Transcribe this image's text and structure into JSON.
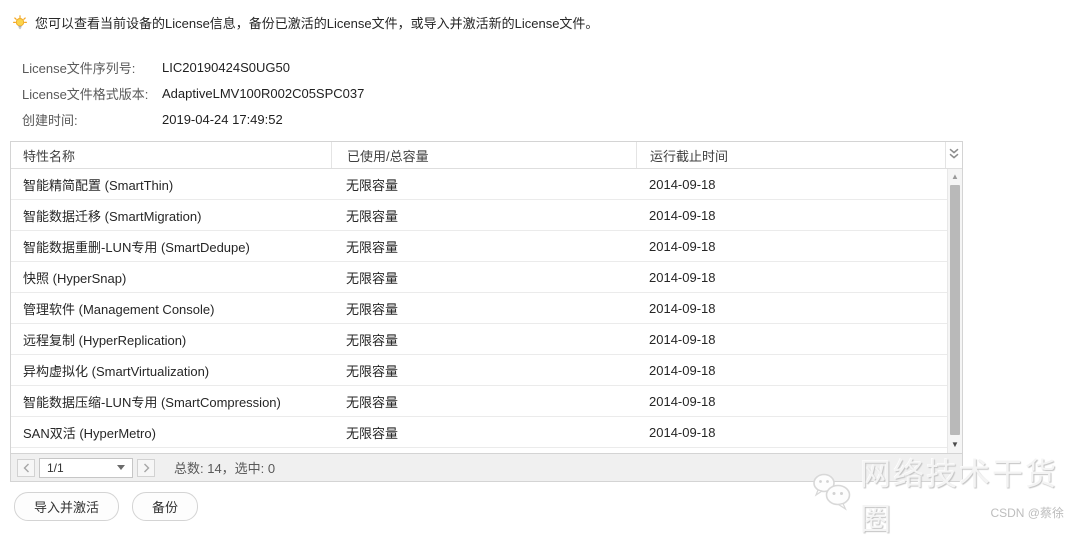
{
  "tip": {
    "text": "您可以查看当前设备的License信息，备份已激活的License文件，或导入并激活新的License文件。"
  },
  "info": {
    "serial_label": "License文件序列号:",
    "serial_value": "LIC20190424S0UG50",
    "format_label": "License文件格式版本:",
    "format_value": "AdaptiveLMV100R002C05SPC037",
    "created_label": "创建时间:",
    "created_value": "2019-04-24 17:49:52"
  },
  "table": {
    "columns": {
      "name": "特性名称",
      "usage": "已使用/总容量",
      "expiry": "运行截止时间"
    },
    "rows": [
      {
        "name": "智能精简配置 (SmartThin)",
        "usage": "无限容量",
        "expiry": "2014-09-18"
      },
      {
        "name": "智能数据迁移 (SmartMigration)",
        "usage": "无限容量",
        "expiry": "2014-09-18"
      },
      {
        "name": "智能数据重删-LUN专用 (SmartDedupe)",
        "usage": "无限容量",
        "expiry": "2014-09-18"
      },
      {
        "name": "快照 (HyperSnap)",
        "usage": "无限容量",
        "expiry": "2014-09-18"
      },
      {
        "name": "管理软件 (Management Console)",
        "usage": "无限容量",
        "expiry": "2014-09-18"
      },
      {
        "name": "远程复制 (HyperReplication)",
        "usage": "无限容量",
        "expiry": "2014-09-18"
      },
      {
        "name": "异构虚拟化 (SmartVirtualization)",
        "usage": "无限容量",
        "expiry": "2014-09-18"
      },
      {
        "name": "智能数据压缩-LUN专用 (SmartCompression)",
        "usage": "无限容量",
        "expiry": "2014-09-18"
      },
      {
        "name": "SAN双活 (HyperMetro)",
        "usage": "无限容量",
        "expiry": "2014-09-18"
      }
    ]
  },
  "pagination": {
    "page_value": "1/1",
    "summary": "总数: 14，选中: 0"
  },
  "actions": {
    "import_label": "导入并激活",
    "backup_label": "备份"
  },
  "watermark": {
    "brand": "网络技术干货圈",
    "credit": "CSDN @蔡徐"
  },
  "icons": {
    "tip": "lightbulb-icon",
    "header_right": "double-chevron-down-icon",
    "scroll_up": "arrow-up-icon",
    "scroll_down": "arrow-down-icon",
    "logo": "wechat-bubbles-logo"
  },
  "colors": {
    "border": "#d4d4d4",
    "row_separator": "#ebebeb",
    "pagebar_bg": "#f0f0f0",
    "scroll_thumb": "#b9b9b9",
    "bulb_yellow": "#fbd44b",
    "text_primary": "#262626",
    "text_secondary": "#595959"
  }
}
